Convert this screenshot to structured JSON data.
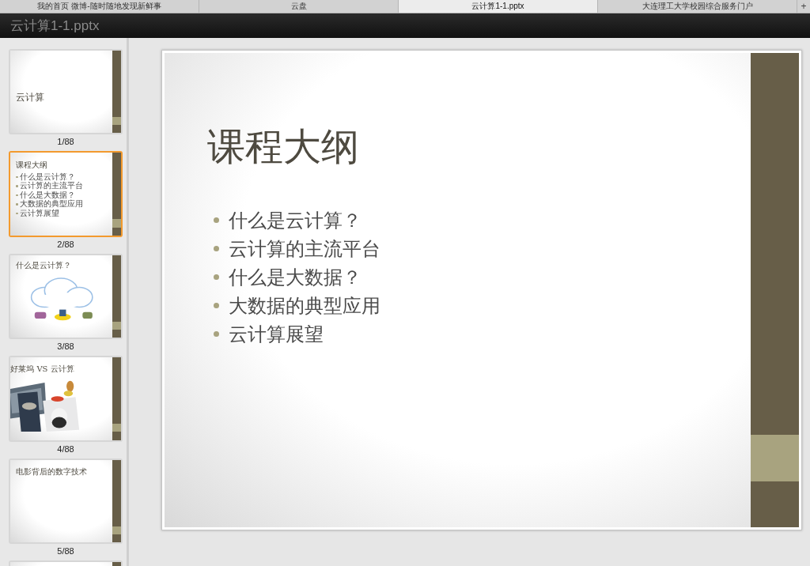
{
  "browser_tabs": [
    {
      "label": "我的首页 微博-随时随地发现新鲜事",
      "selected": false
    },
    {
      "label": "云盘",
      "selected": false
    },
    {
      "label": "云计算1-1.pptx",
      "selected": true
    },
    {
      "label": "大连理工大学校园综合服务门户",
      "selected": false
    }
  ],
  "new_tab": "+",
  "document_title": "云计算1-1.pptx",
  "thumbnails": [
    {
      "kind": "title",
      "number": "1/88",
      "selected": false,
      "title": "云计算"
    },
    {
      "kind": "bullets",
      "number": "2/88",
      "selected": true,
      "title": "课程大纲",
      "bullets": [
        "什么是云计算？",
        "云计算的主流平台",
        "什么是大数据？",
        "大数据的典型应用",
        "云计算展望"
      ]
    },
    {
      "kind": "cloud",
      "number": "3/88",
      "selected": false,
      "title": "什么是云计算？"
    },
    {
      "kind": "collage",
      "number": "4/88",
      "selected": false,
      "title": "好莱坞 VS 云计算"
    },
    {
      "kind": "bullets",
      "number": "5/88",
      "selected": false,
      "title": "电影背后的数字技术"
    },
    {
      "kind": "partial",
      "selected": false
    }
  ],
  "slide": {
    "title": "课程大纲",
    "bullets": [
      "什么是云计算？",
      "云计算的主流平台",
      "什么是大数据？",
      "大数据的典型应用",
      "云计算展望"
    ]
  }
}
